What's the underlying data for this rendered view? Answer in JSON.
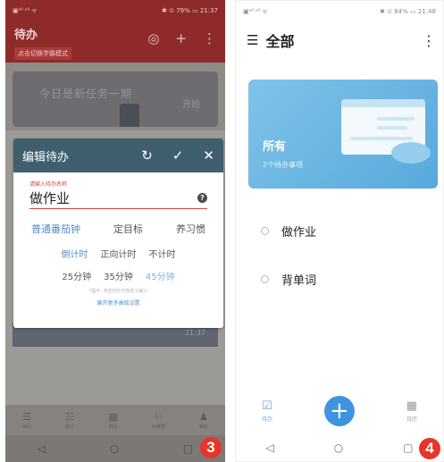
{
  "left": {
    "status_left": "▣ᵃˡˡ ᵃˡˡ ᯤ",
    "status_right": "✱ ⊙ 79% ▭ 21:37",
    "app_title": "待办",
    "app_subtitle": "点击切换学霸模式",
    "banner_text": "今日是新任务一期",
    "banner_sub": "开始",
    "lower_card_time": "21:37",
    "dialog": {
      "title": "编辑待办",
      "refresh_icon": "↻",
      "confirm_icon": "✓",
      "close_icon": "✕",
      "field_label": "请输入待办名称",
      "field_value": "做作业",
      "help_icon": "?",
      "modes": [
        "普通番茄钟",
        "定目标",
        "养习惯"
      ],
      "timers": [
        "倒计时",
        "正向计时",
        "不计时"
      ],
      "durations": [
        "25分钟",
        "35分钟",
        "45分钟"
      ],
      "note": "*提示: 点击时长可自定义输入",
      "more_link": "展开更多高级设置"
    },
    "nav": [
      {
        "icon": "☰",
        "label": "待办"
      },
      {
        "icon": "☷",
        "label": "统计"
      },
      {
        "icon": "▦",
        "label": "日历"
      },
      {
        "icon": "⚐",
        "label": "自律圈"
      },
      {
        "icon": "♟",
        "label": "我的"
      }
    ],
    "sys_nav": [
      "◁",
      "○",
      "▢"
    ],
    "badge": "3"
  },
  "right": {
    "status_left": "▣ᵃˡˡ ᵃˡˡ ᯤ",
    "status_right": "✱ ⊙ 84% ▭ 21:48",
    "menu_icon": "☰",
    "title": "全部",
    "more_icon": "⋮",
    "card_title": "所有",
    "card_sub": "2个待办事项",
    "items": [
      "做作业",
      "背单词"
    ],
    "nav": [
      {
        "icon": "☑",
        "label": "待办"
      },
      {
        "icon": "▦",
        "label": "日历"
      }
    ],
    "fab_icon": "+",
    "sys_nav": [
      "◁",
      "○",
      "▢"
    ],
    "badge": "4"
  }
}
